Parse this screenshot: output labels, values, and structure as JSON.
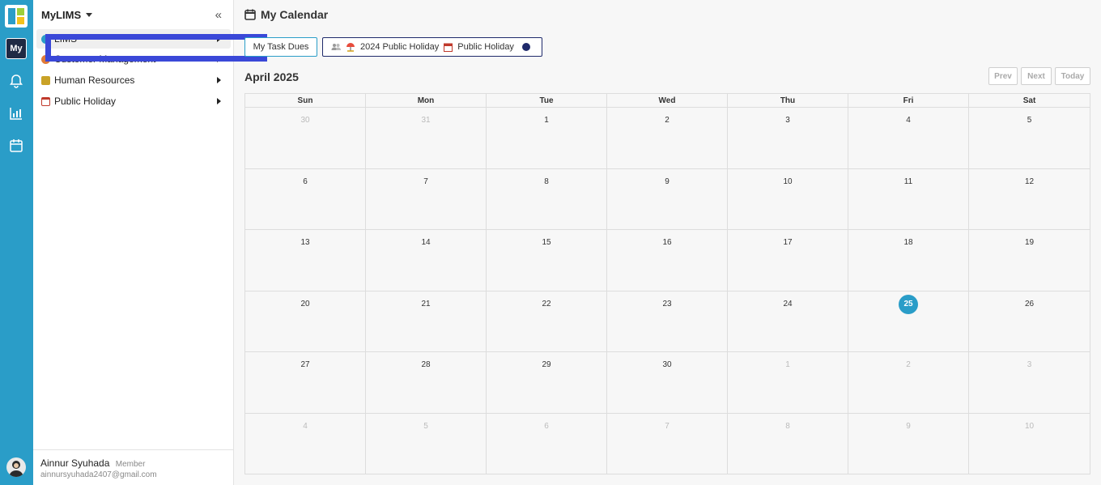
{
  "app": {
    "title": "MyLIMS",
    "rail_my_label": "My"
  },
  "sidebar": {
    "items": [
      {
        "label": "LIMS",
        "icon": "globe-icon",
        "color": "#2a9dc8"
      },
      {
        "label": "Customer Management",
        "icon": "customer-icon",
        "color": "#e07b39"
      },
      {
        "label": "Human Resources",
        "icon": "hr-icon",
        "color": "#c9a227"
      },
      {
        "label": "Public Holiday",
        "icon": "calendar-icon",
        "color": "#c0392b"
      }
    ]
  },
  "user": {
    "name": "Ainnur Syuhada",
    "role": "Member",
    "email": "ainnursyuhada2407@gmail.com"
  },
  "main": {
    "title": "My Calendar",
    "task_button": "My Task Dues",
    "filters": {
      "holiday_2024": "2024 Public Holiday",
      "public_holiday": "Public Holiday"
    },
    "month_label": "April 2025",
    "nav": {
      "prev": "Prev",
      "next": "Next",
      "today": "Today"
    },
    "weekdays": [
      "Sun",
      "Mon",
      "Tue",
      "Wed",
      "Thu",
      "Fri",
      "Sat"
    ],
    "days": [
      {
        "d": "30",
        "o": true
      },
      {
        "d": "31",
        "o": true
      },
      {
        "d": "1"
      },
      {
        "d": "2"
      },
      {
        "d": "3"
      },
      {
        "d": "4"
      },
      {
        "d": "5"
      },
      {
        "d": "6"
      },
      {
        "d": "7"
      },
      {
        "d": "8"
      },
      {
        "d": "9"
      },
      {
        "d": "10"
      },
      {
        "d": "11"
      },
      {
        "d": "12"
      },
      {
        "d": "13"
      },
      {
        "d": "14"
      },
      {
        "d": "15"
      },
      {
        "d": "16"
      },
      {
        "d": "17"
      },
      {
        "d": "18"
      },
      {
        "d": "19"
      },
      {
        "d": "20"
      },
      {
        "d": "21"
      },
      {
        "d": "22"
      },
      {
        "d": "23"
      },
      {
        "d": "24"
      },
      {
        "d": "25",
        "t": true
      },
      {
        "d": "26"
      },
      {
        "d": "27"
      },
      {
        "d": "28"
      },
      {
        "d": "29"
      },
      {
        "d": "30"
      },
      {
        "d": "1",
        "o": true
      },
      {
        "d": "2",
        "o": true
      },
      {
        "d": "3",
        "o": true
      },
      {
        "d": "4",
        "o": true
      },
      {
        "d": "5",
        "o": true
      },
      {
        "d": "6",
        "o": true
      },
      {
        "d": "7",
        "o": true
      },
      {
        "d": "8",
        "o": true
      },
      {
        "d": "9",
        "o": true
      },
      {
        "d": "10",
        "o": true
      }
    ]
  },
  "colors": {
    "accent": "#2a9dc8",
    "highlight": "#3a48d8",
    "navy": "#1f2a6b"
  }
}
